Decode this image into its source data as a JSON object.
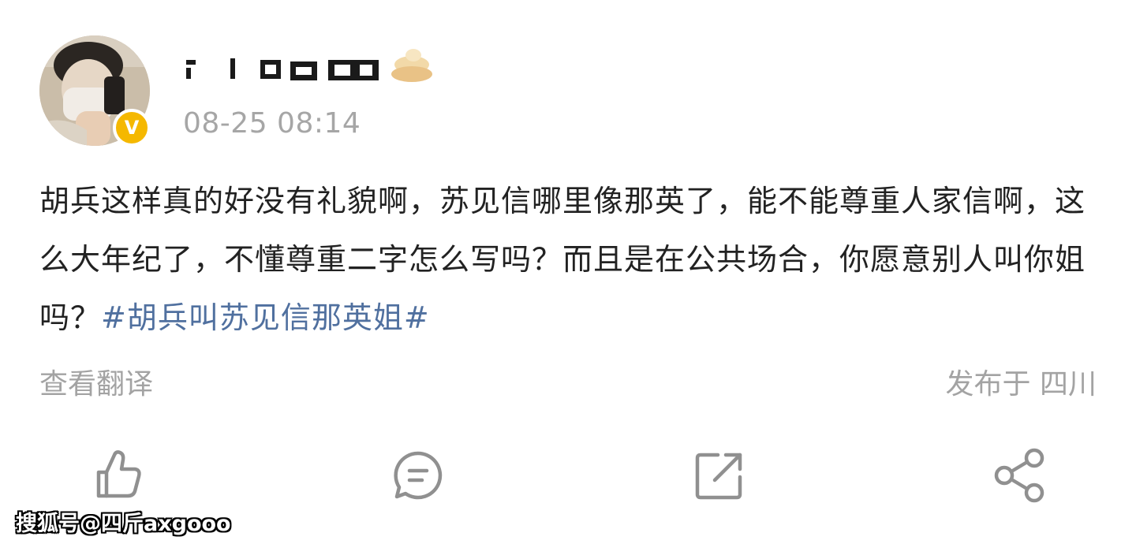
{
  "post": {
    "author": {
      "avatar": "avatar-photo",
      "verified_badge": "V",
      "verified_color": "#f5b800",
      "username": ""
    },
    "timestamp": "08-25 08:14",
    "body_text": "胡兵这样真的好没有礼貌啊，苏见信哪里像那英了，能不能尊重人家信啊，这么大年纪了，不懂尊重二字怎么写吗？而且是在公共场合，你愿意别人叫你姐吗？",
    "hashtag": "#胡兵叫苏见信那英姐#",
    "hashtag_color": "#50709f",
    "translate_label": "查看翻译",
    "location_label": "发布于 四川"
  },
  "actions": [
    {
      "name": "like",
      "icon": "thumbs-up-icon"
    },
    {
      "name": "comment",
      "icon": "comment-icon"
    },
    {
      "name": "repost",
      "icon": "repost-icon"
    },
    {
      "name": "share",
      "icon": "share-icon"
    }
  ],
  "watermark": "搜狐号@四斤axgooo"
}
